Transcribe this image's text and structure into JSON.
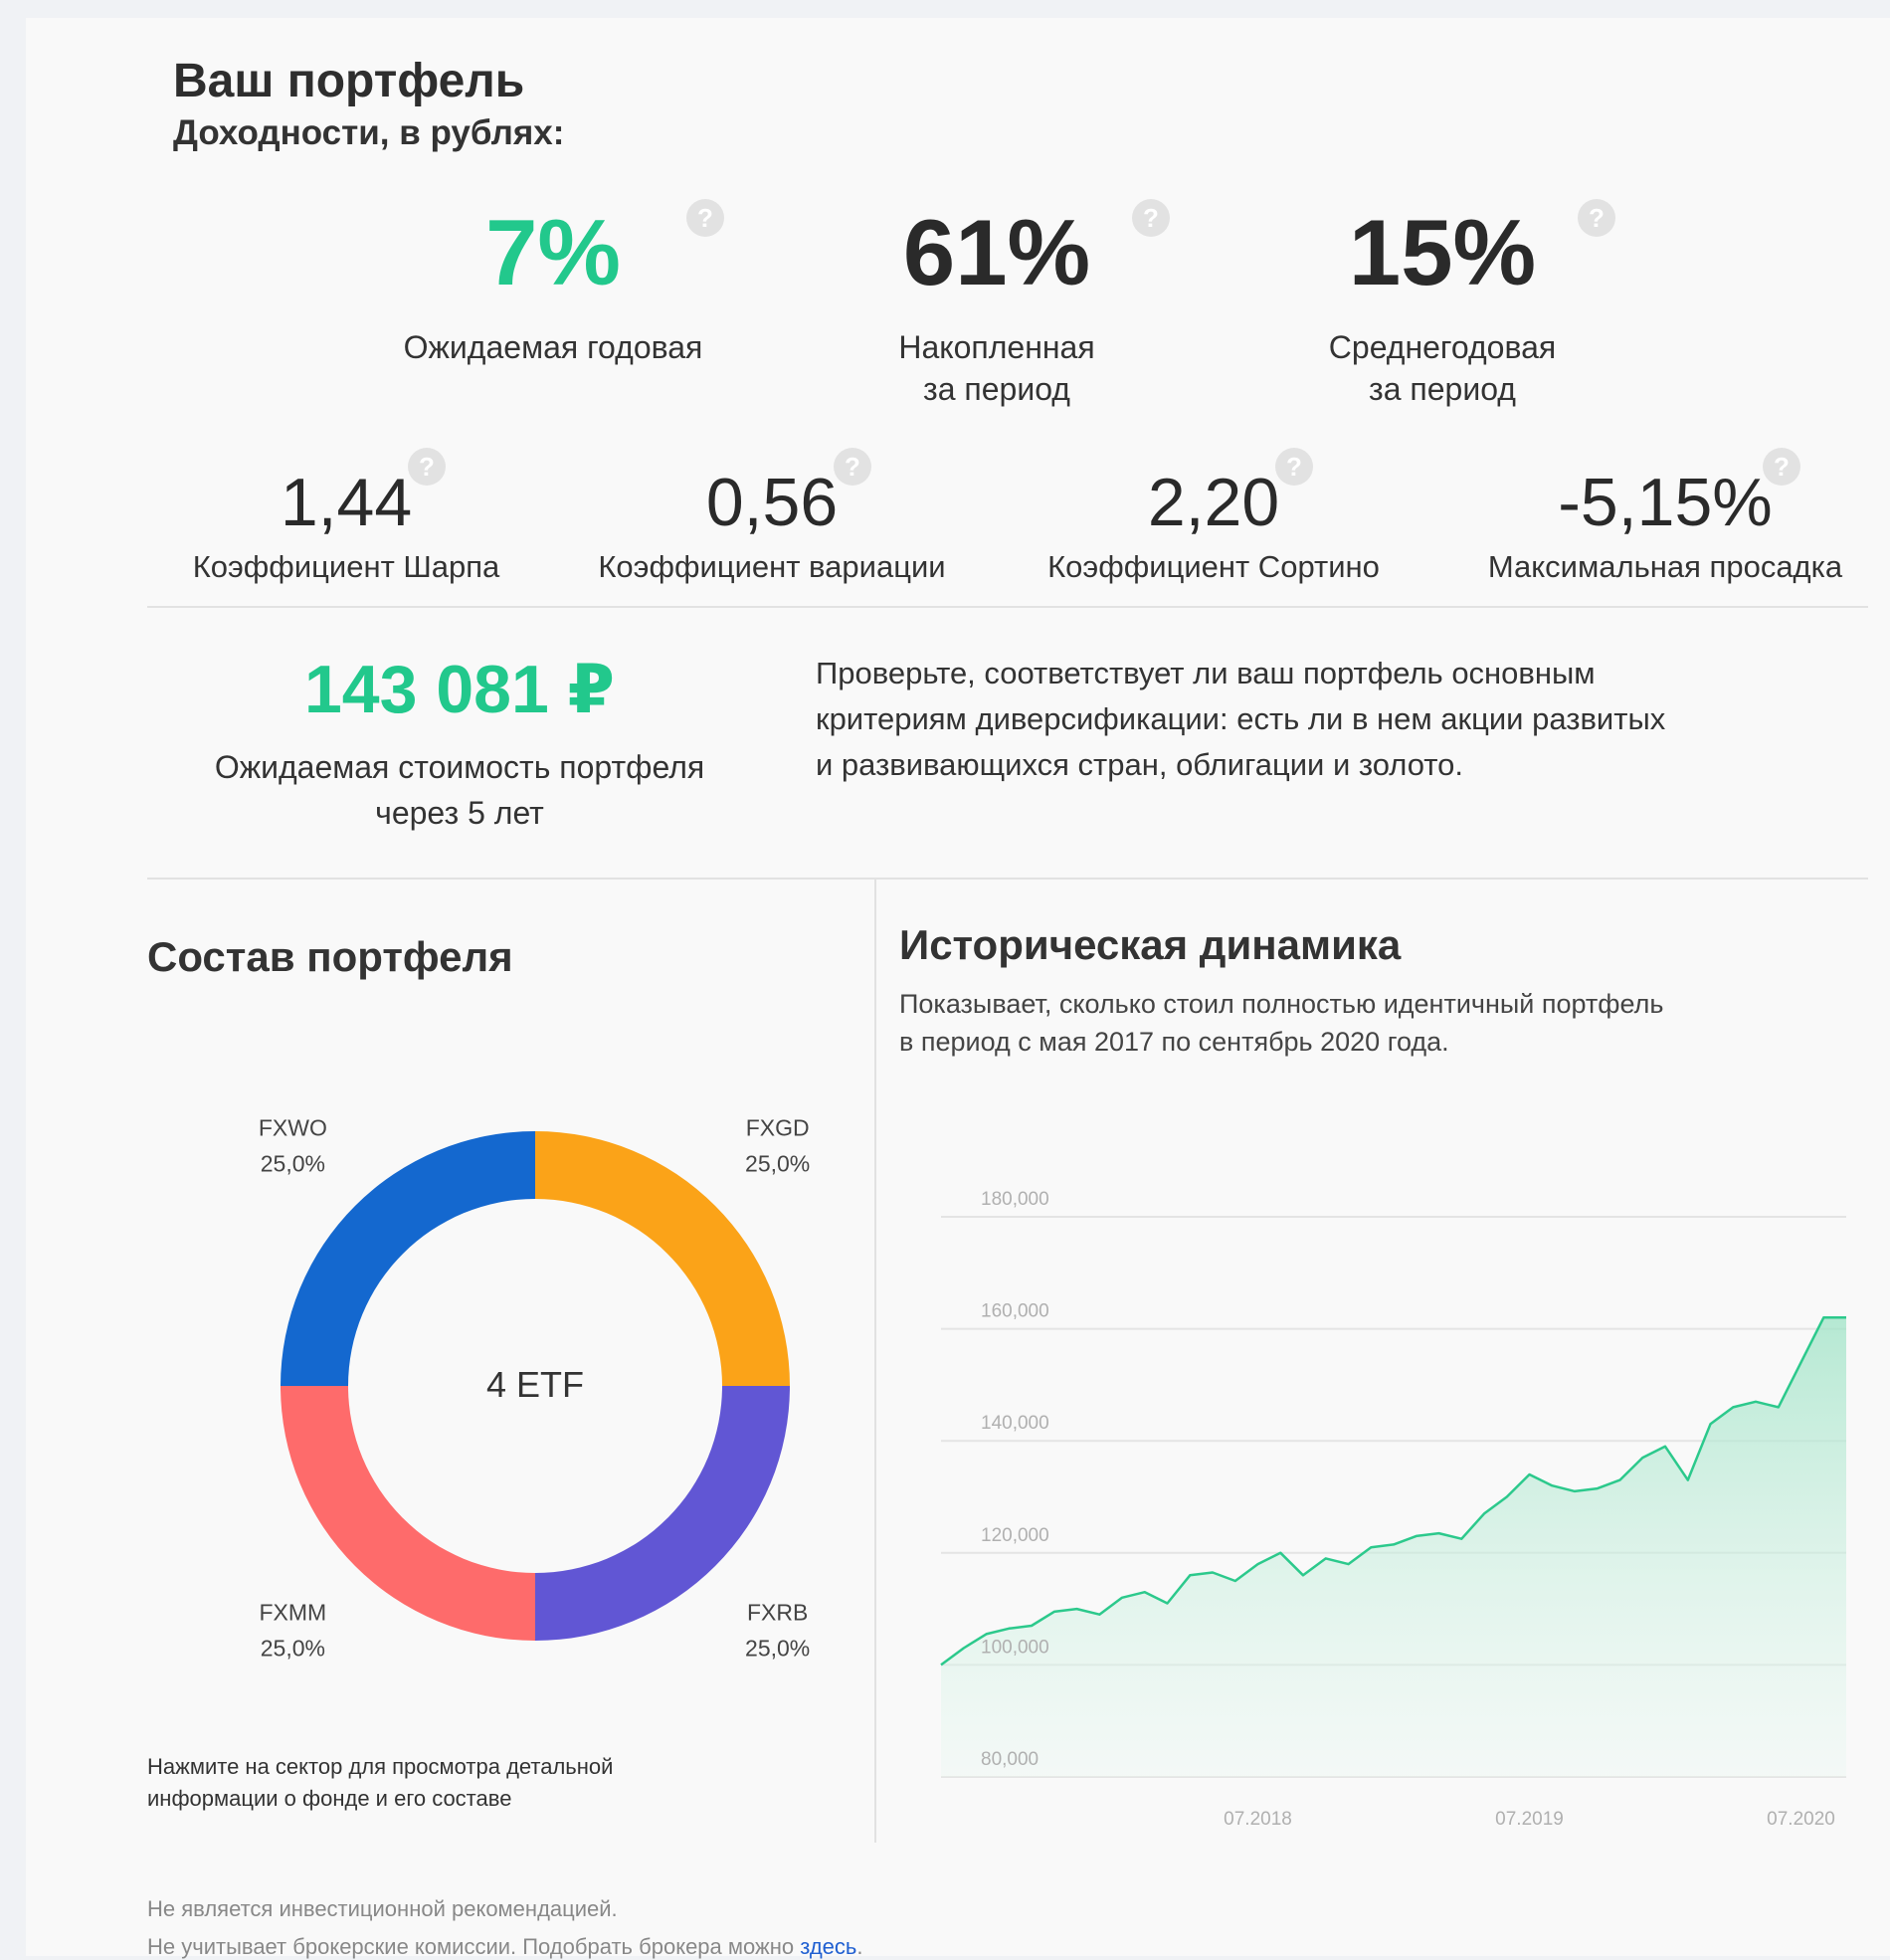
{
  "header": {
    "title": "Ваш портфель",
    "subtitle": "Доходности, в рублях:"
  },
  "help_glyph": "?",
  "top_metrics": [
    {
      "value": "7%",
      "label_line1": "Ожидаемая годовая",
      "label_line2": "",
      "color": "#22c88c"
    },
    {
      "value": "61%",
      "label_line1": "Накопленная",
      "label_line2": "за период",
      "color": "#2a2a2a"
    },
    {
      "value": "15%",
      "label_line1": "Среднегодовая",
      "label_line2": "за период",
      "color": "#2a2a2a"
    }
  ],
  "ratios": [
    {
      "value": "1,44",
      "label": "Коэффициент Шарпа"
    },
    {
      "value": "0,56",
      "label": "Коэффициент вариации"
    },
    {
      "value": "2,20",
      "label": "Коэффициент Сортино"
    },
    {
      "value": "-5,15%",
      "label": "Максимальная просадка"
    }
  ],
  "forecast": {
    "value": "143 081 ₽",
    "label_line1": "Ожидаемая стоимость портфеля",
    "label_line2": "через 5 лет",
    "advice_line1": "Проверьте, соответствует ли ваш портфель основным",
    "advice_line2": "критериям диверсификации: есть ли в нем акции развитых",
    "advice_line3": "и развивающихся стран, облигации и золото."
  },
  "composition": {
    "title": "Состав портфеля",
    "center_label": "4 ETF",
    "hint_line1": "Нажмите на сектор для просмотра детальной",
    "hint_line2": "информации о фонде и его составе"
  },
  "history": {
    "title": "Историческая динамика",
    "desc_line1": "Показывает, сколько стоил полностью идентичный портфель",
    "desc_line2": "в период с мая 2017 по сентябрь 2020 года."
  },
  "footer": {
    "line1": "Не является инвестиционной рекомендацией.",
    "line2_text": "Не учитывает брокерские комиссии. Подобрать брокера можно ",
    "line2_link": "здесь",
    "line2_end": "."
  },
  "chart_data": [
    {
      "type": "pie",
      "title": "",
      "donut": true,
      "categories": [
        "FXGD",
        "FXRB",
        "FXMM",
        "FXWO"
      ],
      "values": [
        25.0,
        25.0,
        25.0,
        25.0
      ],
      "value_labels": [
        "25,0%",
        "25,0%",
        "25,0%",
        "25,0%"
      ],
      "colors": [
        "#fba318",
        "#6156d4",
        "#fe6b6b",
        "#1468cf"
      ]
    },
    {
      "type": "area",
      "title": "",
      "xlabel": "",
      "ylabel": "",
      "ylim": [
        80000,
        180000
      ],
      "yticks": [
        80000,
        100000,
        120000,
        140000,
        160000,
        180000
      ],
      "ytick_labels": [
        "80,000",
        "100,000",
        "120,000",
        "140,000",
        "160,000",
        "180,000"
      ],
      "xtick_labels": [
        "07.2018",
        "07.2019",
        "07.2020"
      ],
      "xtick_values": [
        "2018-07",
        "2019-07",
        "2020-07"
      ],
      "xlim": [
        "2017-05",
        "2020-09"
      ],
      "grid": true,
      "line_color": "#2cc98c",
      "fill_color": "#d3f2e5",
      "series": [
        {
          "name": "",
          "x": [
            "2017-05",
            "2017-06",
            "2017-07",
            "2017-08",
            "2017-09",
            "2017-10",
            "2017-11",
            "2017-12",
            "2018-01",
            "2018-02",
            "2018-03",
            "2018-04",
            "2018-05",
            "2018-06",
            "2018-07",
            "2018-08",
            "2018-09",
            "2018-10",
            "2018-11",
            "2018-12",
            "2019-01",
            "2019-02",
            "2019-03",
            "2019-04",
            "2019-05",
            "2019-06",
            "2019-07",
            "2019-08",
            "2019-09",
            "2019-10",
            "2019-11",
            "2019-12",
            "2020-01",
            "2020-02",
            "2020-03",
            "2020-04",
            "2020-05",
            "2020-06",
            "2020-07",
            "2020-08",
            "2020-09"
          ],
          "values": [
            100000,
            103000,
            105500,
            106500,
            107000,
            109500,
            110000,
            109000,
            112000,
            113000,
            111000,
            116000,
            116500,
            115000,
            118000,
            120000,
            116000,
            119000,
            118000,
            121000,
            121500,
            123000,
            123500,
            122500,
            127000,
            130000,
            134000,
            132000,
            131000,
            131500,
            133000,
            137000,
            139000,
            133000,
            143000,
            146000,
            147000,
            146000,
            154000,
            162000,
            162000
          ]
        }
      ]
    }
  ]
}
